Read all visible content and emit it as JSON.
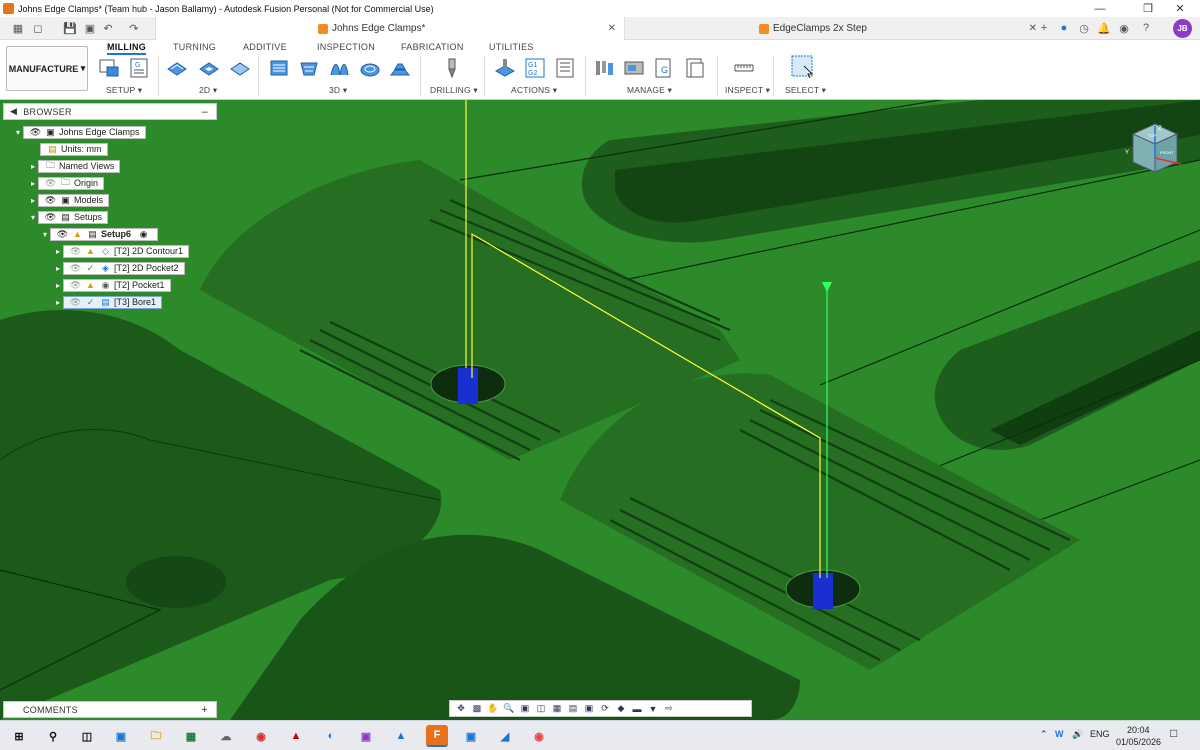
{
  "window": {
    "title": "Johns Edge Clamps* (Team hub - Jason Ballamy) - Autodesk Fusion Personal (Not for Commercial Use)"
  },
  "tabs": {
    "active": "Johns Edge Clamps*",
    "inactive": "EdgeClamps 2x Step",
    "user_initials": "JB"
  },
  "ribbon": {
    "workspace": "MANUFACTURE",
    "tabs": [
      "MILLING",
      "TURNING",
      "ADDITIVE",
      "INSPECTION",
      "FABRICATION",
      "UTILITIES"
    ],
    "groups": [
      "SETUP",
      "2D",
      "3D",
      "DRILLING",
      "ACTIONS",
      "MANAGE",
      "INSPECT",
      "SELECT"
    ]
  },
  "browser": {
    "header": "BROWSER",
    "root": "Johns Edge Clamps",
    "units": "Units: mm",
    "named_views": "Named Views",
    "origin": "Origin",
    "models": "Models",
    "setups": "Setups",
    "setup": "Setup6",
    "operations": [
      {
        "label": "[T2] 2D Contour1",
        "status": "warning"
      },
      {
        "label": "[T2] 2D Pocket2",
        "status": "ok"
      },
      {
        "label": "[T2] Pocket1",
        "status": "warning"
      },
      {
        "label": "[T3] Bore1",
        "status": "ok"
      }
    ]
  },
  "viewcube": {
    "top": "TOP",
    "front": "FRONT",
    "z": "Z",
    "y": "Y"
  },
  "comments": {
    "label": "COMMENTS"
  },
  "taskbar": {
    "lang": "ENG",
    "time": "20:04",
    "date": "01/05/2026"
  },
  "colors": {
    "stock": "#2e8a2a",
    "toolpath": "#ffff33",
    "tool": "#1a2fd0",
    "accent": "#1b76d2"
  }
}
